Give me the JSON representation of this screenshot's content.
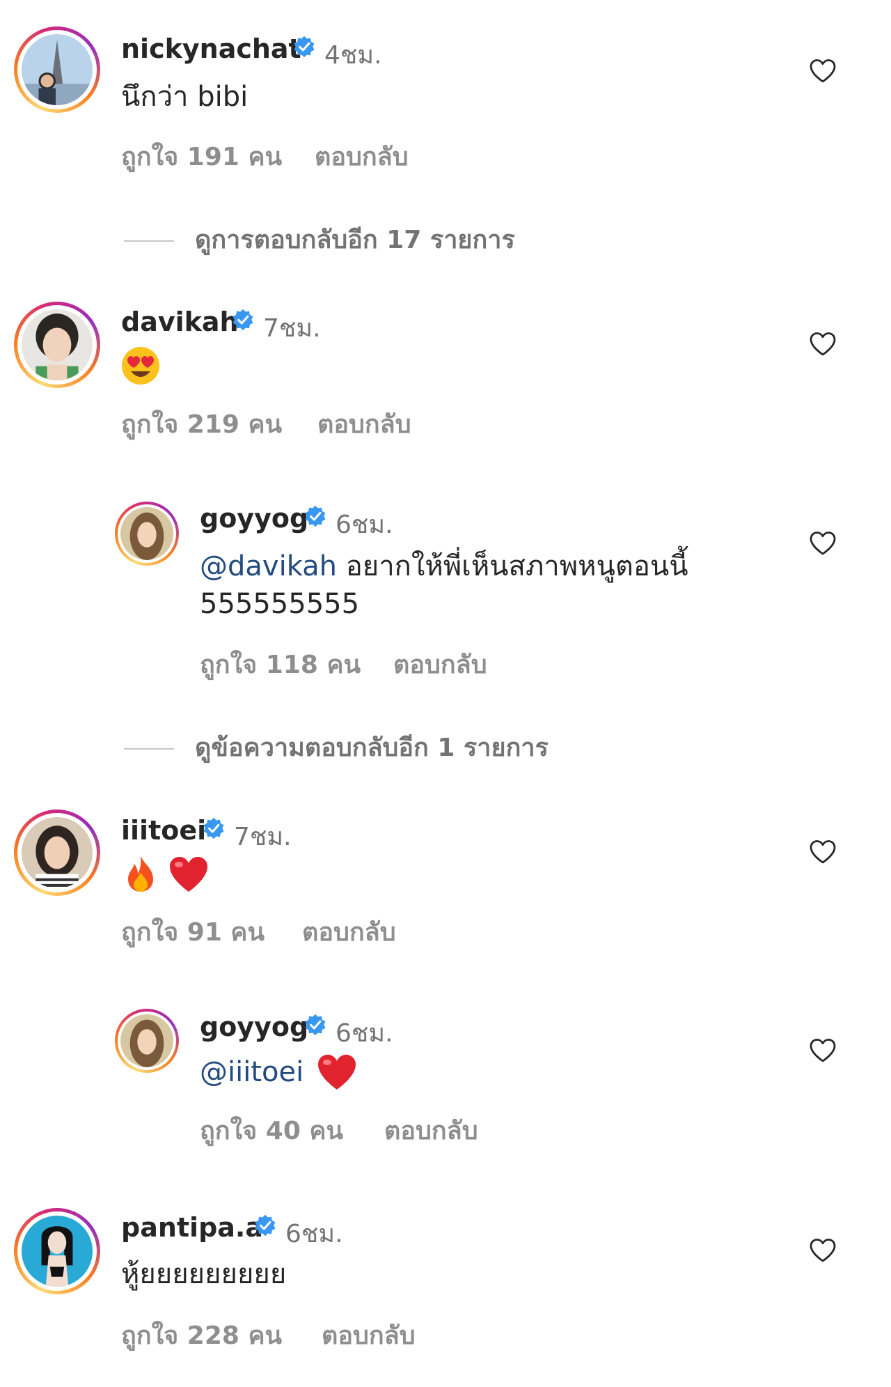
{
  "comments": [
    {
      "username": "nickynachat",
      "time": "4ชม.",
      "text": "นึกว่า bibi",
      "likes": "ถูกใจ 191 คน",
      "reply": "ตอบกลับ"
    },
    {
      "username": "davikah",
      "time": "7ชม.",
      "likes": "ถูกใจ 219 คน",
      "reply": "ตอบกลับ"
    },
    {
      "username": "goyyog",
      "time": "6ชม.",
      "mention": "@davikah",
      "text": "อยากให้พี่เห็นสภาพหนูตอนนี้ 555555555",
      "likes": "ถูกใจ 118 คน",
      "reply": "ตอบกลับ"
    },
    {
      "username": "iiitoei",
      "time": "7ชม.",
      "likes": "ถูกใจ 91 คน",
      "reply": "ตอบกลับ"
    },
    {
      "username": "goyyog",
      "time": "6ชม.",
      "mention": "@iiitoei",
      "likes": "ถูกใจ 40 คน",
      "reply": "ตอบกลับ"
    },
    {
      "username": "pantipa.a",
      "time": "6ชม.",
      "text": "หู้ยยยยยยยยย",
      "likes": "ถูกใจ 228 คน",
      "reply": "ตอบกลับ"
    }
  ],
  "view_replies": [
    {
      "label": "ดูการตอบกลับอีก 17 รายการ"
    },
    {
      "label": "ดูข้อความตอบกลับอีก 1 รายการ"
    }
  ],
  "icons": {
    "verified": "verified-badge-icon",
    "like": "heart-outline-icon"
  },
  "colors": {
    "verified": "#3897f0",
    "mention": "#234b80",
    "meta": "#8e8e8e"
  }
}
